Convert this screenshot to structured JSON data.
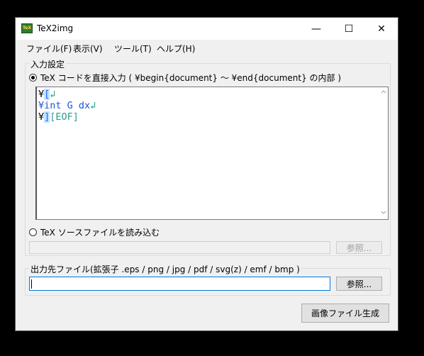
{
  "window": {
    "title": "TeX2img",
    "icon": "tex2img-app-icon",
    "icon_text": "TeX"
  },
  "titlebar": {
    "minimize": "—",
    "maximize": "☐",
    "close": "✕"
  },
  "menu": [
    {
      "label": "ファイル(F)"
    },
    {
      "label": "表示(V)"
    },
    {
      "label": "ツール(T)"
    },
    {
      "label": "ヘルプ(H)"
    }
  ],
  "input_settings": {
    "group_label": "入力設定",
    "direct_input_label": "TeX コードを直接入力 ( ¥begin{document} ～ ¥end{document} の内部 )",
    "direct_input_selected": true,
    "editor_lines": [
      {
        "yen": "¥",
        "bracket": "[",
        "rest": "",
        "end": "↲"
      },
      {
        "yen": "¥",
        "bracket": "",
        "rest": "int G dx",
        "end": "↲"
      },
      {
        "yen": "¥",
        "bracket": "]",
        "rest": "",
        "end": "[EOF]"
      }
    ],
    "source_file_label": "TeX ソースファイルを読み込む",
    "source_file_selected": false,
    "source_file_value": "",
    "browse_label": "参照..."
  },
  "output": {
    "group_label": "出力先ファイル(拡張子 .eps / png / jpg / pdf / svg(z) / emf / bmp )",
    "file_value": "",
    "browse_label": "参照..."
  },
  "generate_button": "画像ファイル生成"
}
